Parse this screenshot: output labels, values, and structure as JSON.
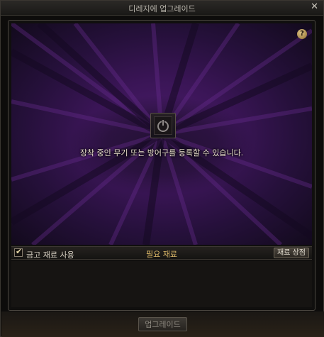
{
  "window": {
    "title": "디레지에 업그레이드",
    "close_glyph": "✕"
  },
  "stage": {
    "help_glyph": "?",
    "slot_icon": "power-icon",
    "hint": "장착 중인 무기 또는 방어구를 등록할 수 있습니다."
  },
  "materials": {
    "use_safe_label": "금고 재료 사용",
    "use_safe_checked": true,
    "checkmark_glyph": "✔",
    "required_label": "필요 재료",
    "shop_button_label": "재료 상점"
  },
  "footer": {
    "upgrade_button_label": "업그레이드",
    "upgrade_button_enabled": false
  },
  "colors": {
    "accent_purple": "#4c1d6d",
    "gold_text": "#d9b667"
  }
}
